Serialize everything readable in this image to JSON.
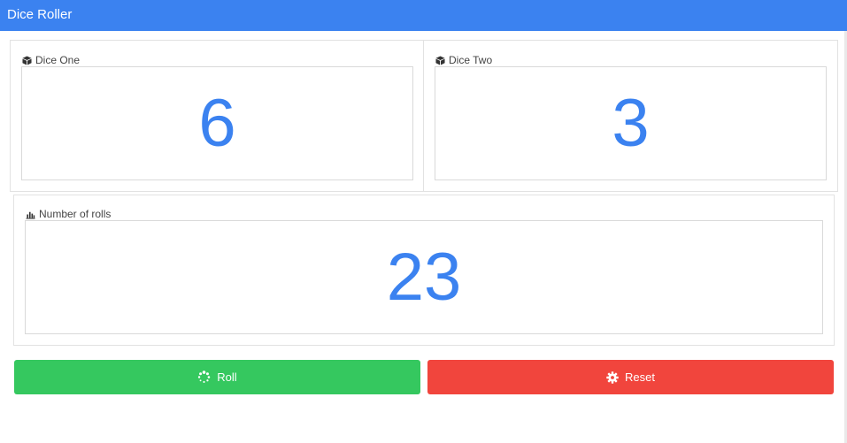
{
  "app": {
    "title": "Dice Roller"
  },
  "dice_one": {
    "label": "Dice One",
    "value": "6"
  },
  "dice_two": {
    "label": "Dice Two",
    "value": "3"
  },
  "rolls": {
    "label": "Number of rolls",
    "value": "23"
  },
  "buttons": {
    "roll_label": "Roll",
    "reset_label": "Reset"
  },
  "colors": {
    "titlebar": "#3b82f0",
    "value_text": "#3b82f0",
    "roll_button": "#35c85f",
    "reset_button": "#f1453d"
  },
  "icons": {
    "dice_one": "cube-icon",
    "dice_two": "cube-icon",
    "rolls": "bar-chart-icon",
    "roll_button": "spinner-icon",
    "reset_button": "cog-icon"
  }
}
